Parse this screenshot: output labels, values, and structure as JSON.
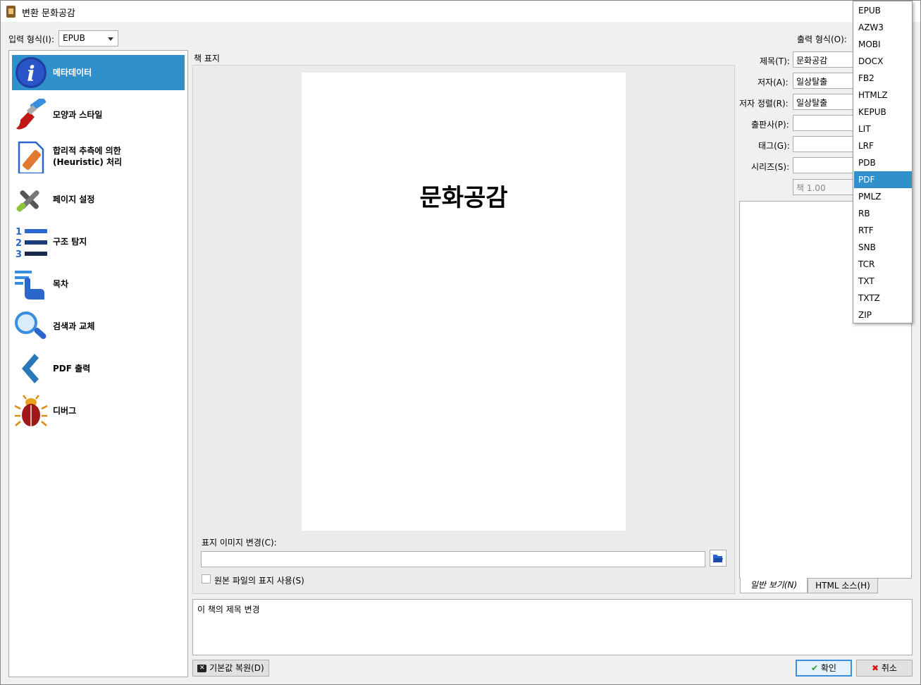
{
  "window": {
    "title": "변환 문화공감"
  },
  "input_format": {
    "label": "입력 형식(I):",
    "value": "EPUB"
  },
  "output_format": {
    "label": "출력 형식(O):"
  },
  "nav": {
    "items": [
      {
        "label": "메타데이터",
        "icon": "info-icon"
      },
      {
        "label": "모양과 스타일",
        "icon": "brush-icon"
      },
      {
        "label": "합리적 추측에 의한",
        "label2": "(Heuristic) 처리",
        "icon": "heuristic-icon"
      },
      {
        "label": "페이지 설정",
        "icon": "tools-icon"
      },
      {
        "label": "구조 탐지",
        "icon": "numbered-list-icon"
      },
      {
        "label": "목차",
        "icon": "toc-icon"
      },
      {
        "label": "검색과 교체",
        "icon": "search-icon"
      },
      {
        "label": "PDF 출력",
        "icon": "chevron-left-icon"
      },
      {
        "label": "디버그",
        "icon": "bug-icon"
      }
    ]
  },
  "cover": {
    "group_label": "책 표지",
    "title_text": "문화공감",
    "change_label": "표지 이미지 변경(C):",
    "path_value": "",
    "use_source_label": "원본 파일의 표지 사용(S)"
  },
  "meta": {
    "title_label": "제목(T):",
    "title_value": "문화공감",
    "author_label": "저자(A):",
    "author_value": "일상탈출",
    "author_sort_label": "저자 정렬(R):",
    "author_sort_value": "일상탈출",
    "publisher_label": "출판사(P):",
    "publisher_value": "",
    "tags_label": "태그(G):",
    "tags_value": "",
    "series_label": "시리즈(S):",
    "series_value": "",
    "series_index": "책 1.00"
  },
  "tabs": {
    "normal": "일반 보기(N)",
    "html": "HTML 소스(H)"
  },
  "help_text": "이 책의 제목 변경",
  "buttons": {
    "restore": "기본값 복원(D)",
    "ok": "확인",
    "cancel": "취소"
  },
  "dropdown": {
    "options": [
      "EPUB",
      "AZW3",
      "MOBI",
      "DOCX",
      "FB2",
      "HTMLZ",
      "KEPUB",
      "LIT",
      "LRF",
      "PDB",
      "PDF",
      "PMLZ",
      "RB",
      "RTF",
      "SNB",
      "TCR",
      "TXT",
      "TXTZ",
      "ZIP"
    ],
    "selected": "PDF"
  },
  "colors": {
    "selection": "#3090cc"
  }
}
